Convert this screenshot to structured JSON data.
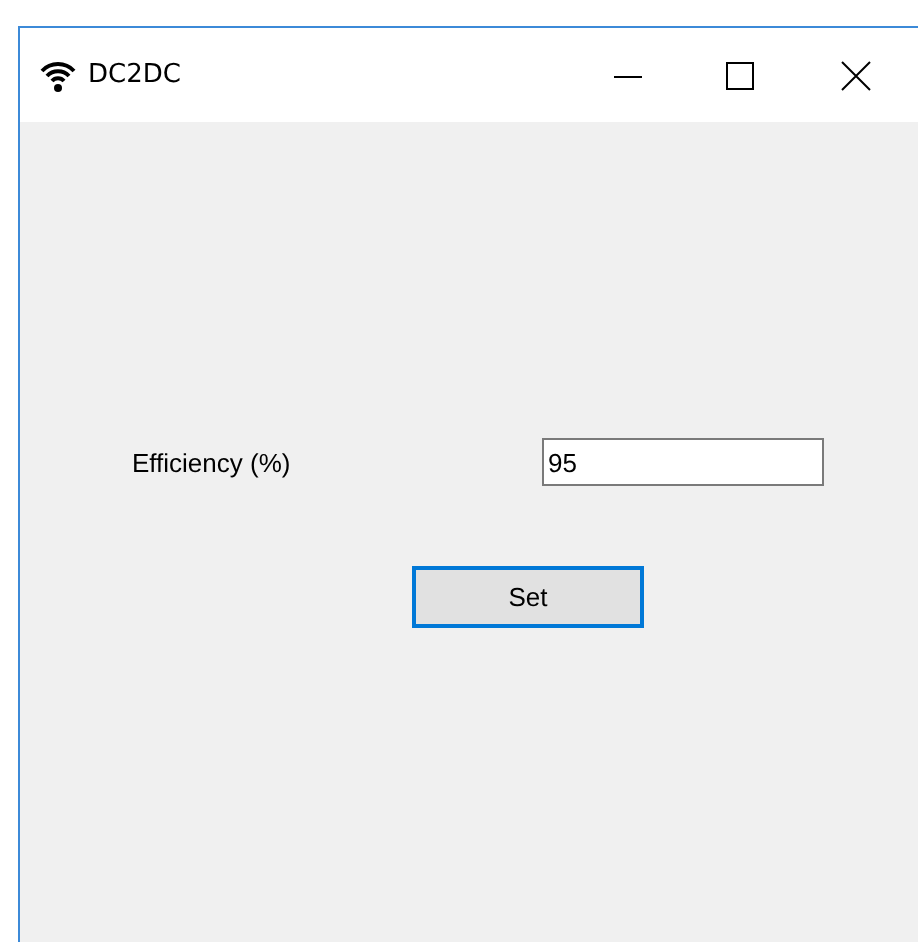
{
  "window": {
    "title": "DC2DC"
  },
  "form": {
    "field_label": "Efficiency (%)",
    "field_value": "95",
    "button": {
      "label": "Set",
      "focused": true
    }
  }
}
